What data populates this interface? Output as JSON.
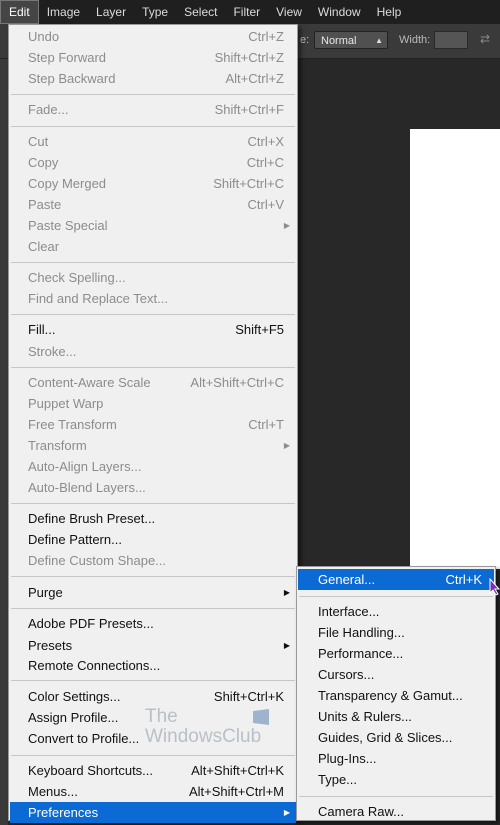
{
  "menubar": {
    "items": [
      {
        "label": "Edit",
        "active": true
      },
      {
        "label": "Image"
      },
      {
        "label": "Layer"
      },
      {
        "label": "Type"
      },
      {
        "label": "Select"
      },
      {
        "label": "Filter"
      },
      {
        "label": "View"
      },
      {
        "label": "Window"
      },
      {
        "label": "Help"
      }
    ]
  },
  "options_bar": {
    "mode_label_fragment": "e:",
    "mode_value": "Normal",
    "width_label": "Width:"
  },
  "edit_menu": {
    "items": [
      {
        "label": "Undo",
        "shortcut": "Ctrl+Z",
        "disabled": true
      },
      {
        "label": "Step Forward",
        "shortcut": "Shift+Ctrl+Z",
        "disabled": true
      },
      {
        "label": "Step Backward",
        "shortcut": "Alt+Ctrl+Z",
        "disabled": true
      },
      {
        "label": "Fade...",
        "shortcut": "Shift+Ctrl+F",
        "disabled": true
      },
      {
        "label": "Cut",
        "shortcut": "Ctrl+X",
        "disabled": true
      },
      {
        "label": "Copy",
        "shortcut": "Ctrl+C",
        "disabled": true
      },
      {
        "label": "Copy Merged",
        "shortcut": "Shift+Ctrl+C",
        "disabled": true
      },
      {
        "label": "Paste",
        "shortcut": "Ctrl+V",
        "disabled": true
      },
      {
        "label": "Paste Special",
        "shortcut": "",
        "disabled": true,
        "submenu": true
      },
      {
        "label": "Clear",
        "shortcut": "",
        "disabled": true
      },
      {
        "label": "Check Spelling...",
        "shortcut": "",
        "disabled": true
      },
      {
        "label": "Find and Replace Text...",
        "shortcut": "",
        "disabled": true
      },
      {
        "label": "Fill...",
        "shortcut": "Shift+F5",
        "disabled": false
      },
      {
        "label": "Stroke...",
        "shortcut": "",
        "disabled": true
      },
      {
        "label": "Content-Aware Scale",
        "shortcut": "Alt+Shift+Ctrl+C",
        "disabled": true
      },
      {
        "label": "Puppet Warp",
        "shortcut": "",
        "disabled": true
      },
      {
        "label": "Free Transform",
        "shortcut": "Ctrl+T",
        "disabled": true
      },
      {
        "label": "Transform",
        "shortcut": "",
        "disabled": true,
        "submenu": true
      },
      {
        "label": "Auto-Align Layers...",
        "shortcut": "",
        "disabled": true
      },
      {
        "label": "Auto-Blend Layers...",
        "shortcut": "",
        "disabled": true
      },
      {
        "label": "Define Brush Preset...",
        "shortcut": "",
        "disabled": false
      },
      {
        "label": "Define Pattern...",
        "shortcut": "",
        "disabled": false
      },
      {
        "label": "Define Custom Shape...",
        "shortcut": "",
        "disabled": true
      },
      {
        "label": "Purge",
        "shortcut": "",
        "disabled": false,
        "submenu": true
      },
      {
        "label": "Adobe PDF Presets...",
        "shortcut": "",
        "disabled": false
      },
      {
        "label": "Presets",
        "shortcut": "",
        "disabled": false,
        "submenu": true
      },
      {
        "label": "Remote Connections...",
        "shortcut": "",
        "disabled": false
      },
      {
        "label": "Color Settings...",
        "shortcut": "Shift+Ctrl+K",
        "disabled": false
      },
      {
        "label": "Assign Profile...",
        "shortcut": "",
        "disabled": false
      },
      {
        "label": "Convert to Profile...",
        "shortcut": "",
        "disabled": false
      },
      {
        "label": "Keyboard Shortcuts...",
        "shortcut": "Alt+Shift+Ctrl+K",
        "disabled": false
      },
      {
        "label": "Menus...",
        "shortcut": "Alt+Shift+Ctrl+M",
        "disabled": false
      },
      {
        "label": "Preferences",
        "shortcut": "",
        "disabled": false,
        "submenu": true,
        "highlighted": true
      }
    ]
  },
  "preferences_submenu": {
    "items": [
      {
        "label": "General...",
        "shortcut": "Ctrl+K",
        "highlighted": true
      },
      {
        "label": "Interface..."
      },
      {
        "label": "File Handling..."
      },
      {
        "label": "Performance..."
      },
      {
        "label": "Cursors..."
      },
      {
        "label": "Transparency & Gamut..."
      },
      {
        "label": "Units & Rulers..."
      },
      {
        "label": "Guides, Grid & Slices..."
      },
      {
        "label": "Plug-Ins..."
      },
      {
        "label": "Type..."
      },
      {
        "label": "Camera Raw..."
      }
    ]
  },
  "watermark": {
    "line1": "The",
    "line2": "WindowsClub"
  },
  "colors": {
    "highlight": "#0b6ad3",
    "menu_bg": "#f0f0f0",
    "disabled_text": "#8c8c8c",
    "app_bg": "#282828"
  }
}
